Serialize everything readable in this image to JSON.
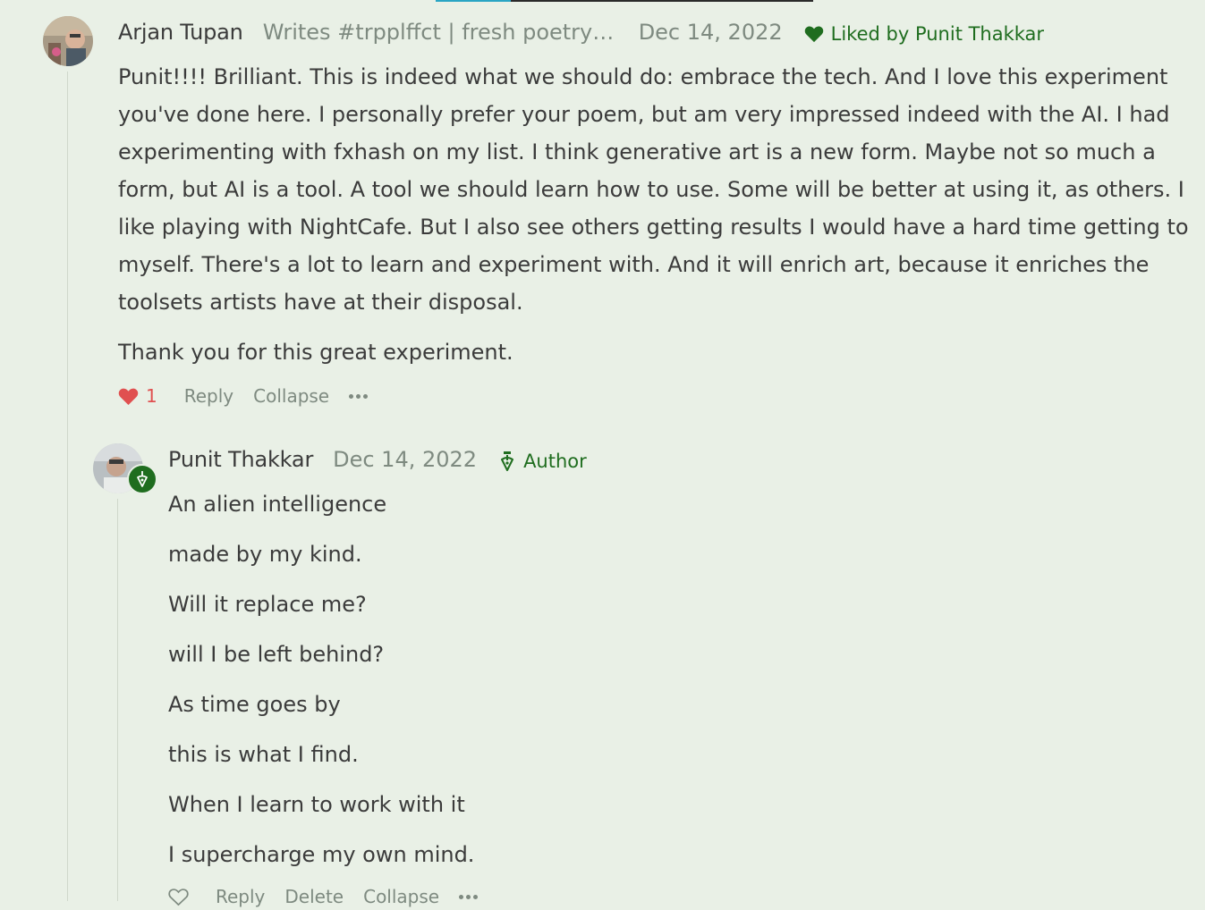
{
  "comments": [
    {
      "author": "Arjan Tupan",
      "bio": "Writes #trpplffct | fresh poetry & fri...",
      "date": "Dec 14, 2022",
      "liked_by": "Liked by Punit Thakkar",
      "paragraphs": [
        "Punit!!!! Brilliant. This is indeed what we should do: embrace the tech. And I love this experiment you've done here. I personally prefer your poem, but am very impressed indeed with the AI. I had experimenting with fxhash on my list. I think generative art is a new form. Maybe not so much a form, but AI is a tool. A tool we should learn how to use. Some will be better at using it, as others. I like playing with NightCafe. But I also see others getting results I would have a hard time getting to myself. There's a lot to learn and experiment with. And it will enrich art, because it enriches the toolsets artists have at their disposal.",
        "Thank you for this great experiment."
      ],
      "like_count": "1",
      "actions": {
        "reply": "Reply",
        "collapse": "Collapse"
      },
      "icons": {
        "like": "heart-filled-icon",
        "more": "more-dots-icon",
        "liked_by": "heart-icon"
      }
    },
    {
      "author": "Punit Thakkar",
      "date": "Dec 14, 2022",
      "author_tag": "Author",
      "poem_lines": [
        "An alien intelligence",
        "made by my kind.",
        "Will it replace me?",
        "will I be left behind?",
        "As time goes by",
        "this is what I find.",
        "When I learn to work with it",
        "I supercharge my own mind."
      ],
      "actions": {
        "reply": "Reply",
        "delete": "Delete",
        "collapse": "Collapse"
      },
      "icons": {
        "like": "heart-outline-icon",
        "more": "more-dots-icon",
        "author": "pen-nib-icon"
      }
    }
  ],
  "colors": {
    "background": "#e9f0e6",
    "accent_green": "#1f6d1f",
    "like_red": "#e05050",
    "muted": "#7e8a80",
    "text": "#3b3b3b"
  }
}
